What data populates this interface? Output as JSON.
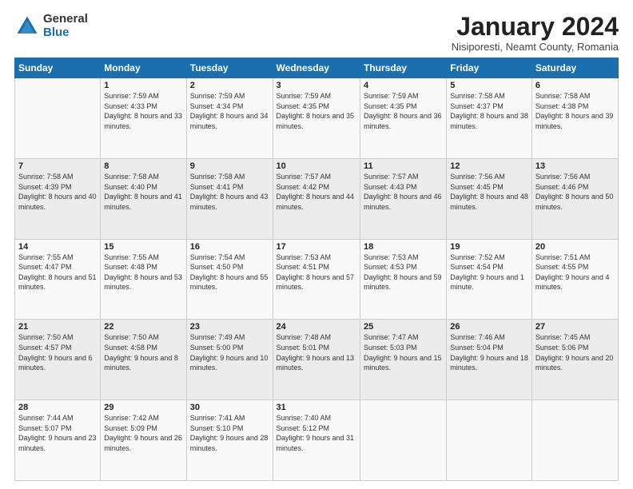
{
  "logo": {
    "general": "General",
    "blue": "Blue"
  },
  "title": "January 2024",
  "location": "Nisiporesti, Neamt County, Romania",
  "days_of_week": [
    "Sunday",
    "Monday",
    "Tuesday",
    "Wednesday",
    "Thursday",
    "Friday",
    "Saturday"
  ],
  "weeks": [
    [
      {
        "day": "",
        "sunrise": "",
        "sunset": "",
        "daylight": ""
      },
      {
        "day": "1",
        "sunrise": "Sunrise: 7:59 AM",
        "sunset": "Sunset: 4:33 PM",
        "daylight": "Daylight: 8 hours and 33 minutes."
      },
      {
        "day": "2",
        "sunrise": "Sunrise: 7:59 AM",
        "sunset": "Sunset: 4:34 PM",
        "daylight": "Daylight: 8 hours and 34 minutes."
      },
      {
        "day": "3",
        "sunrise": "Sunrise: 7:59 AM",
        "sunset": "Sunset: 4:35 PM",
        "daylight": "Daylight: 8 hours and 35 minutes."
      },
      {
        "day": "4",
        "sunrise": "Sunrise: 7:59 AM",
        "sunset": "Sunset: 4:35 PM",
        "daylight": "Daylight: 8 hours and 36 minutes."
      },
      {
        "day": "5",
        "sunrise": "Sunrise: 7:58 AM",
        "sunset": "Sunset: 4:37 PM",
        "daylight": "Daylight: 8 hours and 38 minutes."
      },
      {
        "day": "6",
        "sunrise": "Sunrise: 7:58 AM",
        "sunset": "Sunset: 4:38 PM",
        "daylight": "Daylight: 8 hours and 39 minutes."
      }
    ],
    [
      {
        "day": "7",
        "sunrise": "Sunrise: 7:58 AM",
        "sunset": "Sunset: 4:39 PM",
        "daylight": "Daylight: 8 hours and 40 minutes."
      },
      {
        "day": "8",
        "sunrise": "Sunrise: 7:58 AM",
        "sunset": "Sunset: 4:40 PM",
        "daylight": "Daylight: 8 hours and 41 minutes."
      },
      {
        "day": "9",
        "sunrise": "Sunrise: 7:58 AM",
        "sunset": "Sunset: 4:41 PM",
        "daylight": "Daylight: 8 hours and 43 minutes."
      },
      {
        "day": "10",
        "sunrise": "Sunrise: 7:57 AM",
        "sunset": "Sunset: 4:42 PM",
        "daylight": "Daylight: 8 hours and 44 minutes."
      },
      {
        "day": "11",
        "sunrise": "Sunrise: 7:57 AM",
        "sunset": "Sunset: 4:43 PM",
        "daylight": "Daylight: 8 hours and 46 minutes."
      },
      {
        "day": "12",
        "sunrise": "Sunrise: 7:56 AM",
        "sunset": "Sunset: 4:45 PM",
        "daylight": "Daylight: 8 hours and 48 minutes."
      },
      {
        "day": "13",
        "sunrise": "Sunrise: 7:56 AM",
        "sunset": "Sunset: 4:46 PM",
        "daylight": "Daylight: 8 hours and 50 minutes."
      }
    ],
    [
      {
        "day": "14",
        "sunrise": "Sunrise: 7:55 AM",
        "sunset": "Sunset: 4:47 PM",
        "daylight": "Daylight: 8 hours and 51 minutes."
      },
      {
        "day": "15",
        "sunrise": "Sunrise: 7:55 AM",
        "sunset": "Sunset: 4:48 PM",
        "daylight": "Daylight: 8 hours and 53 minutes."
      },
      {
        "day": "16",
        "sunrise": "Sunrise: 7:54 AM",
        "sunset": "Sunset: 4:50 PM",
        "daylight": "Daylight: 8 hours and 55 minutes."
      },
      {
        "day": "17",
        "sunrise": "Sunrise: 7:53 AM",
        "sunset": "Sunset: 4:51 PM",
        "daylight": "Daylight: 8 hours and 57 minutes."
      },
      {
        "day": "18",
        "sunrise": "Sunrise: 7:53 AM",
        "sunset": "Sunset: 4:53 PM",
        "daylight": "Daylight: 8 hours and 59 minutes."
      },
      {
        "day": "19",
        "sunrise": "Sunrise: 7:52 AM",
        "sunset": "Sunset: 4:54 PM",
        "daylight": "Daylight: 9 hours and 1 minute."
      },
      {
        "day": "20",
        "sunrise": "Sunrise: 7:51 AM",
        "sunset": "Sunset: 4:55 PM",
        "daylight": "Daylight: 9 hours and 4 minutes."
      }
    ],
    [
      {
        "day": "21",
        "sunrise": "Sunrise: 7:50 AM",
        "sunset": "Sunset: 4:57 PM",
        "daylight": "Daylight: 9 hours and 6 minutes."
      },
      {
        "day": "22",
        "sunrise": "Sunrise: 7:50 AM",
        "sunset": "Sunset: 4:58 PM",
        "daylight": "Daylight: 9 hours and 8 minutes."
      },
      {
        "day": "23",
        "sunrise": "Sunrise: 7:49 AM",
        "sunset": "Sunset: 5:00 PM",
        "daylight": "Daylight: 9 hours and 10 minutes."
      },
      {
        "day": "24",
        "sunrise": "Sunrise: 7:48 AM",
        "sunset": "Sunset: 5:01 PM",
        "daylight": "Daylight: 9 hours and 13 minutes."
      },
      {
        "day": "25",
        "sunrise": "Sunrise: 7:47 AM",
        "sunset": "Sunset: 5:03 PM",
        "daylight": "Daylight: 9 hours and 15 minutes."
      },
      {
        "day": "26",
        "sunrise": "Sunrise: 7:46 AM",
        "sunset": "Sunset: 5:04 PM",
        "daylight": "Daylight: 9 hours and 18 minutes."
      },
      {
        "day": "27",
        "sunrise": "Sunrise: 7:45 AM",
        "sunset": "Sunset: 5:06 PM",
        "daylight": "Daylight: 9 hours and 20 minutes."
      }
    ],
    [
      {
        "day": "28",
        "sunrise": "Sunrise: 7:44 AM",
        "sunset": "Sunset: 5:07 PM",
        "daylight": "Daylight: 9 hours and 23 minutes."
      },
      {
        "day": "29",
        "sunrise": "Sunrise: 7:42 AM",
        "sunset": "Sunset: 5:09 PM",
        "daylight": "Daylight: 9 hours and 26 minutes."
      },
      {
        "day": "30",
        "sunrise": "Sunrise: 7:41 AM",
        "sunset": "Sunset: 5:10 PM",
        "daylight": "Daylight: 9 hours and 28 minutes."
      },
      {
        "day": "31",
        "sunrise": "Sunrise: 7:40 AM",
        "sunset": "Sunset: 5:12 PM",
        "daylight": "Daylight: 9 hours and 31 minutes."
      },
      {
        "day": "",
        "sunrise": "",
        "sunset": "",
        "daylight": ""
      },
      {
        "day": "",
        "sunrise": "",
        "sunset": "",
        "daylight": ""
      },
      {
        "day": "",
        "sunrise": "",
        "sunset": "",
        "daylight": ""
      }
    ]
  ]
}
